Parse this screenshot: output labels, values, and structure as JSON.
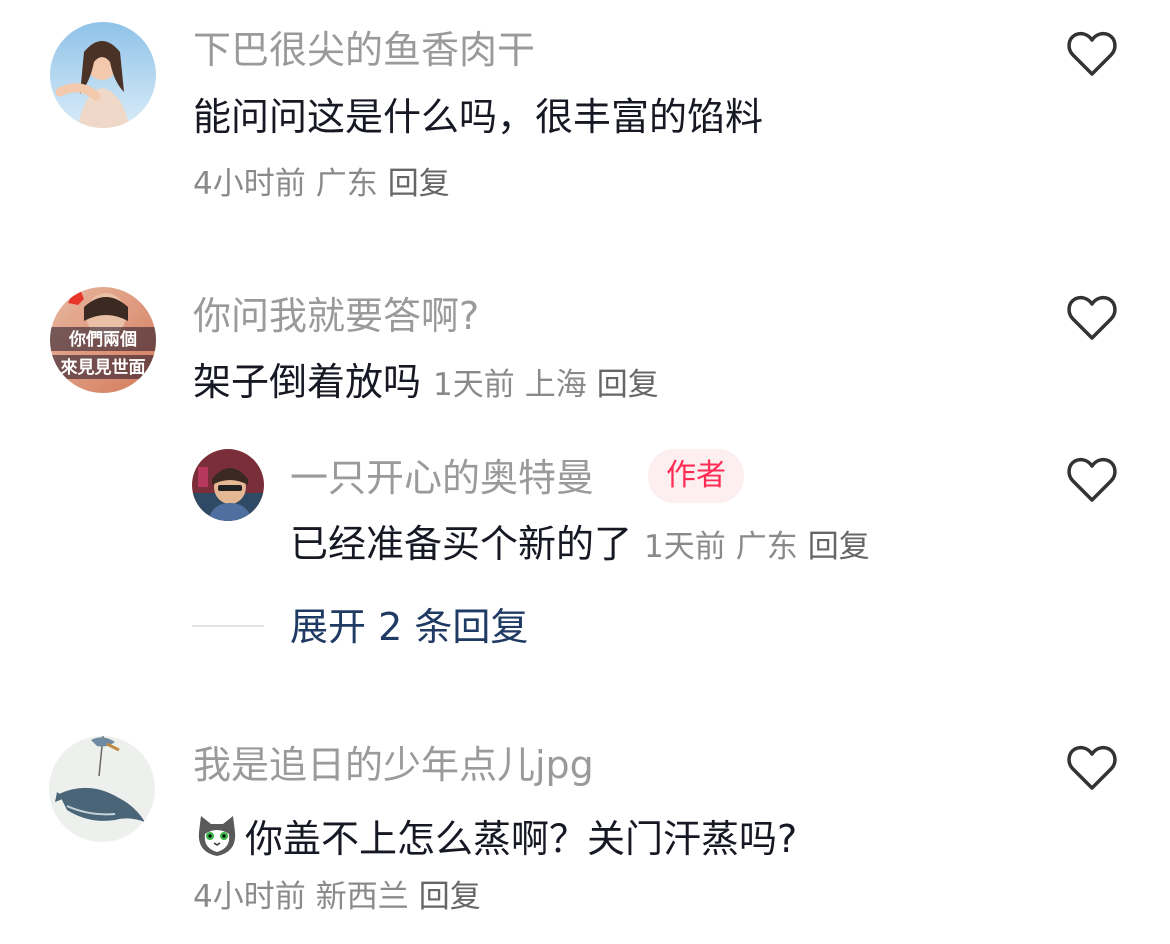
{
  "comments": [
    {
      "username": "下巴很尖的鱼香肉干",
      "text": "能问问这是什么吗，很丰富的馅料",
      "time": "4小时前",
      "location": "广东",
      "reply": "回复"
    },
    {
      "username": "你问我就要答啊?",
      "text": "架子倒着放吗",
      "time": "1天前",
      "location": "上海",
      "reply": "回复",
      "avatar_text_top": "你們兩個",
      "avatar_text_bottom": "來見見世面",
      "replies": [
        {
          "username": "一只开心的奥特曼",
          "badge": "作者",
          "text": "已经准备买个新的了",
          "time": "1天前",
          "location": "广东",
          "reply": "回复"
        }
      ],
      "expand_label": "展开 2 条回复"
    },
    {
      "username": "我是追日的少年点儿jpg",
      "text": "你盖不上怎么蒸啊？关门汗蒸吗?",
      "time": "4小时前",
      "location": "新西兰",
      "reply": "回复"
    }
  ],
  "icons": {
    "like": "heart-outline-icon",
    "emoji": "cat-emoji-icon"
  },
  "colors": {
    "username": "#9a9a9a",
    "meta": "#8a8a8a",
    "author_badge_bg": "#fdeef0",
    "author_badge_text": "#fe2c55",
    "expand_link": "#1f3a63"
  }
}
